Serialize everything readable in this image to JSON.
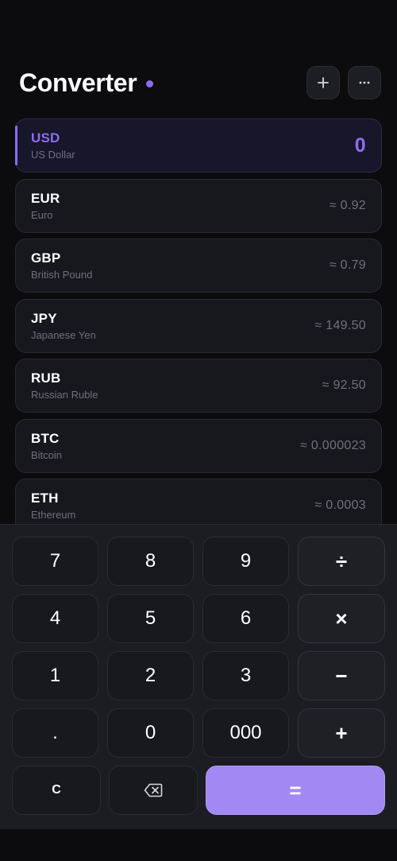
{
  "header": {
    "title": "Converter",
    "add_icon": "plus-icon",
    "more_icon": "ellipsis-icon",
    "accent": "#8b6cf0"
  },
  "currencies": [
    {
      "code": "USD",
      "name": "US Dollar",
      "value": "0",
      "active": true
    },
    {
      "code": "EUR",
      "name": "Euro",
      "value": "≈ 0.92"
    },
    {
      "code": "GBP",
      "name": "British Pound",
      "value": "≈ 0.79"
    },
    {
      "code": "JPY",
      "name": "Japanese Yen",
      "value": "≈ 149.50"
    },
    {
      "code": "RUB",
      "name": "Russian Ruble",
      "value": "≈ 92.50"
    },
    {
      "code": "BTC",
      "name": "Bitcoin",
      "value": "≈ 0.000023"
    },
    {
      "code": "ETH",
      "name": "Ethereum",
      "value": "≈ 0.0003"
    }
  ],
  "keypad": {
    "k7": "7",
    "k8": "8",
    "k9": "9",
    "divide": "÷",
    "k4": "4",
    "k5": "5",
    "k6": "6",
    "multiply": "×",
    "k1": "1",
    "k2": "2",
    "k3": "3",
    "minus": "−",
    "dot": ".",
    "k0": "0",
    "k000": "000",
    "plus": "+",
    "clear": "C",
    "backspace_icon": "backspace-icon",
    "equals": "=",
    "equals_color": "#a288f2"
  }
}
